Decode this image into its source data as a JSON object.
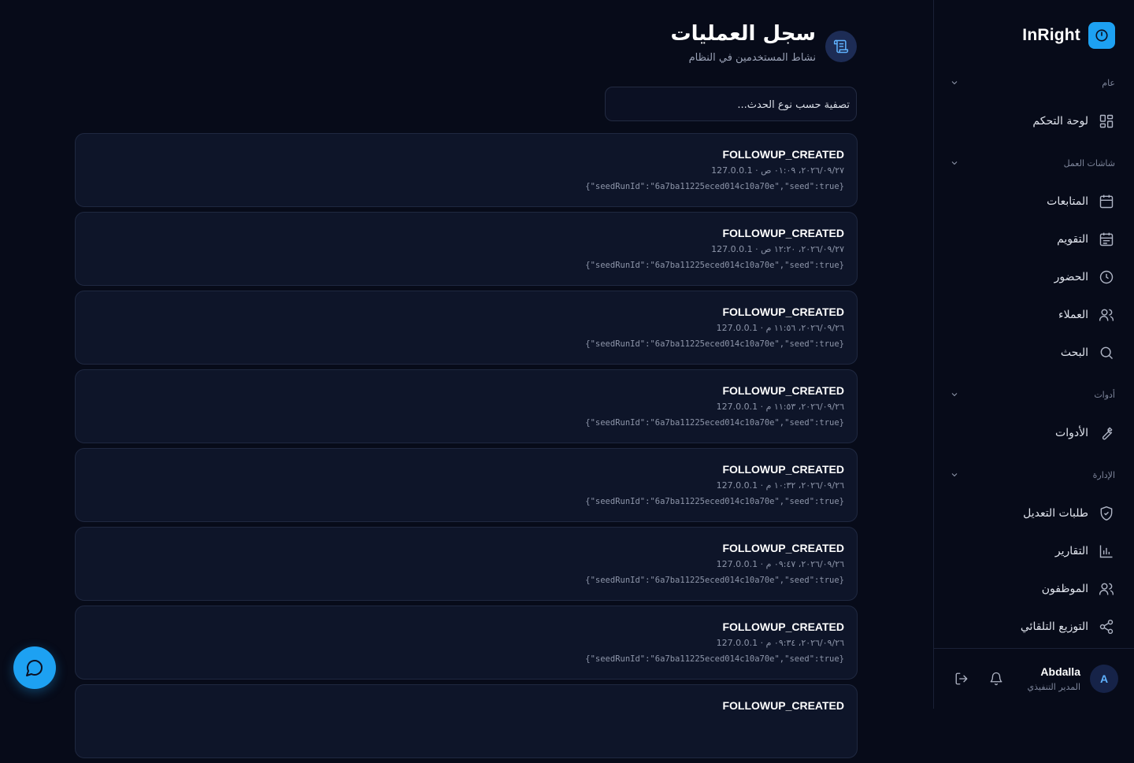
{
  "brand": {
    "name": "InRight",
    "logo_icon": "power-icon",
    "accent": "#1da1f2"
  },
  "sidebar": {
    "sections": [
      {
        "label": "عام",
        "items": [
          {
            "label": "لوحة التحكم",
            "icon": "dashboard-grid-icon"
          }
        ]
      },
      {
        "label": "شاشات العمل",
        "items": [
          {
            "label": "المتابعات",
            "icon": "calendar-icon"
          },
          {
            "label": "التقويم",
            "icon": "calendar-lines-icon"
          },
          {
            "label": "الحضور",
            "icon": "clock-icon"
          },
          {
            "label": "العملاء",
            "icon": "users-icon"
          },
          {
            "label": "البحث",
            "icon": "search-icon"
          }
        ]
      },
      {
        "label": "أدوات",
        "items": [
          {
            "label": "الأدوات",
            "icon": "wrench-icon"
          }
        ]
      },
      {
        "label": "الإدارة",
        "items": [
          {
            "label": "طلبات التعديل",
            "icon": "shield-check-icon"
          },
          {
            "label": "التقارير",
            "icon": "bar-chart-icon"
          },
          {
            "label": "الموظفون",
            "icon": "users-icon"
          },
          {
            "label": "التوزيع التلقائي",
            "icon": "share-icon"
          }
        ]
      }
    ]
  },
  "user": {
    "initial": "A",
    "name": "Abdalla",
    "role": "المدير التنفيذي"
  },
  "header": {
    "title": "سجل العمليات",
    "subtitle": "نشاط المستخدمين في النظام",
    "icon": "scroll-icon"
  },
  "filter": {
    "placeholder": "تصفية حسب نوع الحدث...",
    "value": ""
  },
  "logs": [
    {
      "event": "FOLLOWUP_CREATED",
      "meta": "٢٠٢٦/٠٩/٢٧، ٠١:٠٩ ص · 127.0.0.1",
      "details": "{\"seedRunId\":\"6a7ba11225eced014c10a70e\",\"seed\":true}"
    },
    {
      "event": "FOLLOWUP_CREATED",
      "meta": "٢٠٢٦/٠٩/٢٧، ١٢:٢٠ ص · 127.0.0.1",
      "details": "{\"seedRunId\":\"6a7ba11225eced014c10a70e\",\"seed\":true}"
    },
    {
      "event": "FOLLOWUP_CREATED",
      "meta": "٢٠٢٦/٠٩/٢٦، ١١:٥٦ م · 127.0.0.1",
      "details": "{\"seedRunId\":\"6a7ba11225eced014c10a70e\",\"seed\":true}"
    },
    {
      "event": "FOLLOWUP_CREATED",
      "meta": "٢٠٢٦/٠٩/٢٦، ١١:٥٣ م · 127.0.0.1",
      "details": "{\"seedRunId\":\"6a7ba11225eced014c10a70e\",\"seed\":true}"
    },
    {
      "event": "FOLLOWUP_CREATED",
      "meta": "٢٠٢٦/٠٩/٢٦، ١٠:٣٢ م · 127.0.0.1",
      "details": "{\"seedRunId\":\"6a7ba11225eced014c10a70e\",\"seed\":true}"
    },
    {
      "event": "FOLLOWUP_CREATED",
      "meta": "٢٠٢٦/٠٩/٢٦، ٠٩:٤٧ م · 127.0.0.1",
      "details": "{\"seedRunId\":\"6a7ba11225eced014c10a70e\",\"seed\":true}"
    },
    {
      "event": "FOLLOWUP_CREATED",
      "meta": "٢٠٢٦/٠٩/٢٦، ٠٩:٣٤ م · 127.0.0.1",
      "details": "{\"seedRunId\":\"6a7ba11225eced014c10a70e\",\"seed\":true}"
    },
    {
      "event": "FOLLOWUP_CREATED",
      "meta": "",
      "details": ""
    }
  ],
  "chat": {
    "icon": "chat-bubble-icon"
  }
}
